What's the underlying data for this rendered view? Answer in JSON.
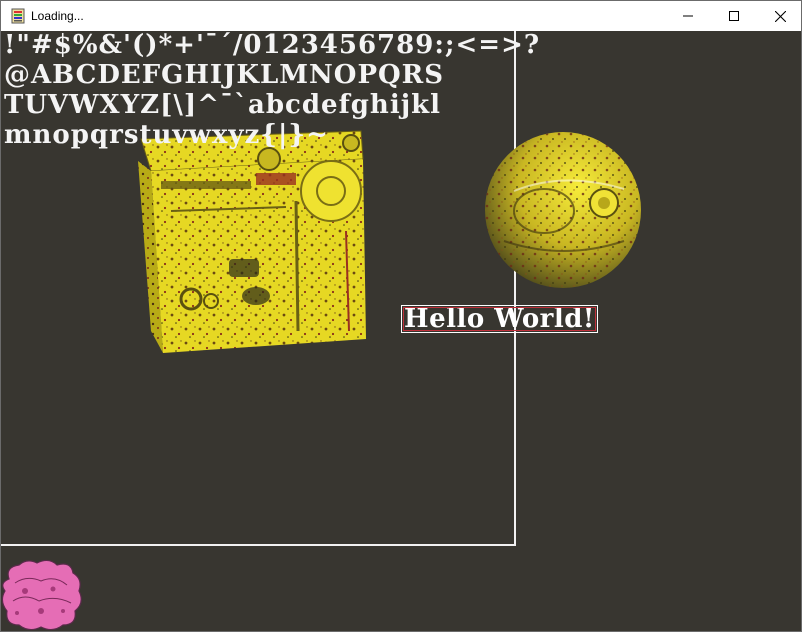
{
  "window": {
    "title": "Loading...",
    "buttons": {
      "minimize": "minimize-icon",
      "maximize": "maximize-icon",
      "close": "close-icon"
    }
  },
  "scene": {
    "background_color": "#383630",
    "font_atlas_lines": [
      "!\"#$%&'()*+'¯´/0123456789:;<=>?",
      "@ABCDEFGHIJKLMNOPQRS",
      "TUVWXYZ[\\]^¯`abcdefghijkl",
      "mnopqrstuvwxyz{|}~"
    ],
    "label_text": "Hello World!",
    "objects": [
      "textured-cube",
      "textured-sphere",
      "pink-blob-sprite"
    ]
  }
}
